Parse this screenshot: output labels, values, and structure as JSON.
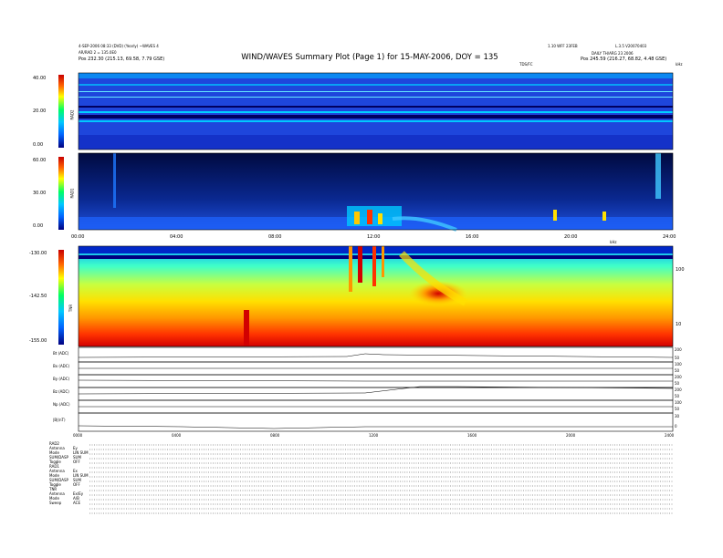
{
  "header": {
    "title": "WIND/WAVES Summary Plot (Page 1) for 15-MAY-2006, DOY = 135",
    "left_line1": "4-SEP-2006 08:33 (DVD) (Yearly) ~WAVES 4",
    "left_line2": "AR/RAD 2 = 135.0E0",
    "left_line3": "Pos  232.30 (215.13, 69.58, 7.79 GSE)",
    "right_line1": "1.10 WFF 23FEB",
    "right_line2": "L.3.5 V20070403",
    "right_line3": "DAILY  TH/ARG 23 2006",
    "right_line4": "Pos  245.59 (216.27, 68.82, 4.48 GSE)",
    "tdsfc_label": "TDS/FC",
    "khz_label": "kHz"
  },
  "colors": {
    "bg": "#ffffff",
    "low": "#0000a0",
    "mid": "#00c8ff",
    "high": "#ff0000"
  },
  "panels": {
    "rad2": {
      "label": "RAD2",
      "ticks": [
        "40.00",
        "20.00",
        "0.00"
      ]
    },
    "rad1": {
      "label": "RAD1",
      "ticks": [
        "60.00",
        "30.00",
        "0.00"
      ]
    },
    "tnr": {
      "label": "TNR",
      "ticks": [
        "-130.00",
        "-142.50",
        "-155.00"
      ],
      "right_ticks": [
        "100",
        "10"
      ],
      "right_unit": "kHz"
    },
    "time_ticks": [
      "00:00",
      "04:00",
      "08:00",
      "12:00",
      "16:00",
      "20:00",
      "24:00"
    ],
    "bottom_time_ticks": [
      "0000",
      "0400",
      "0800",
      "1200",
      "1600",
      "2000",
      "2400"
    ]
  },
  "line_panels": [
    {
      "label": "Bt (ADC)",
      "right_top": "200",
      "right_bot": "50"
    },
    {
      "label": "Bx (ADC)",
      "right_top": "100",
      "right_bot": "50"
    },
    {
      "label": "By (ADC)",
      "right_top": "200",
      "right_bot": "50"
    },
    {
      "label": "Bz (ADC)",
      "right_top": "200",
      "right_bot": "50"
    },
    {
      "label": "Np (ADC)",
      "right_top": "100",
      "right_bot": "50"
    },
    {
      "label": "|B|(nT)",
      "right_top": "30",
      "right_bot": "0"
    }
  ],
  "info": {
    "rad2": {
      "head": "RAD2",
      "rows": [
        [
          "Antenna",
          "Ey"
        ],
        [
          "Mode",
          "LIN SUM"
        ],
        [
          "SUM/DASP",
          "SUM"
        ],
        [
          "Toggle",
          "OFF"
        ]
      ]
    },
    "rad1": {
      "head": "RAD1",
      "rows": [
        [
          "Antenna",
          "Ex"
        ],
        [
          "Mode",
          "LIN SUM"
        ],
        [
          "SUM/DASP",
          "SUM"
        ],
        [
          "Toggle",
          "OFF"
        ]
      ]
    },
    "tnr": {
      "head": "TNR",
      "rows": [
        [
          "Antenna",
          "Ex/Ey"
        ],
        [
          "Mode",
          "A/B"
        ],
        [
          "Sweep",
          "ACE"
        ]
      ]
    }
  },
  "chart_data": {
    "type": "heatmap",
    "title": "WIND/WAVES Summary Plot (Page 1) for 15-MAY-2006, DOY = 135",
    "x": [
      "00:00",
      "04:00",
      "08:00",
      "12:00",
      "16:00",
      "20:00",
      "24:00"
    ],
    "series": [
      {
        "name": "RAD2",
        "range": [
          0,
          40
        ],
        "description": "mostly quiet background with persistent narrow interference lines"
      },
      {
        "name": "RAD1",
        "range": [
          0,
          60
        ],
        "description": "low-level bursts near 00:00-12:00 and enhanced emission around 11:00-13:00"
      },
      {
        "name": "TNR",
        "range": [
          -155,
          -130
        ],
        "description": "intense bursts around 12:00 with an elongated decaying emission 13:00-16:00"
      }
    ],
    "ylim": [
      0,
      60
    ],
    "grid": false,
    "legend": "left colorbars"
  }
}
